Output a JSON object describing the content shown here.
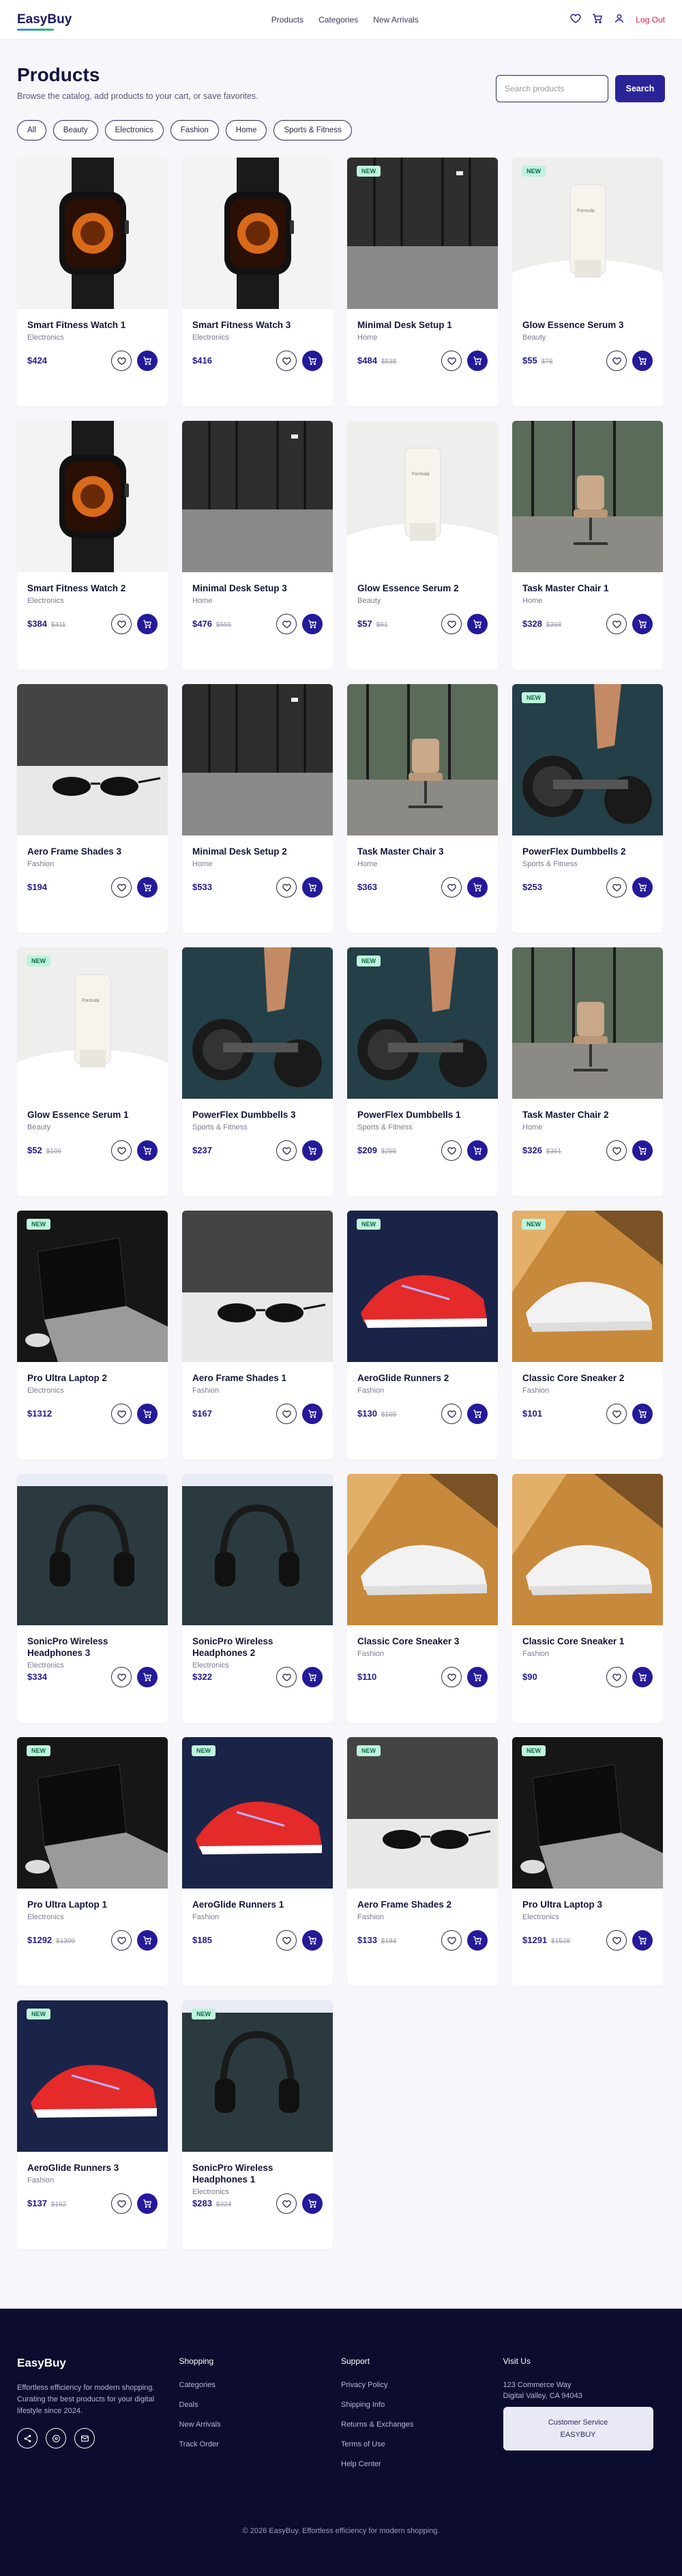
{
  "header": {
    "logo": "EasyBuy",
    "nav": [
      "Products",
      "Categories",
      "New Arrivals"
    ],
    "logout": "Log Out"
  },
  "page": {
    "title": "Products",
    "subtitle": "Browse the catalog, add products to your cart, or save favorites.",
    "search_placeholder": "Search products",
    "search_button": "Search"
  },
  "filters": [
    "All",
    "Beauty",
    "Electronics",
    "Fashion",
    "Home",
    "Sports & Fitness"
  ],
  "badge_label": "NEW",
  "products": [
    {
      "name": "Smart Fitness Watch 1",
      "category": "Electronics",
      "price": "$424",
      "old": "",
      "new": false,
      "theme": "watch"
    },
    {
      "name": "Smart Fitness Watch 3",
      "category": "Electronics",
      "price": "$416",
      "old": "",
      "new": false,
      "theme": "watch"
    },
    {
      "name": "Minimal Desk Setup 1",
      "category": "Home",
      "price": "$484",
      "old": "$538",
      "new": true,
      "theme": "desk"
    },
    {
      "name": "Glow Essence Serum 3",
      "category": "Beauty",
      "price": "$55",
      "old": "$78",
      "new": true,
      "theme": "serum"
    },
    {
      "name": "Smart Fitness Watch 2",
      "category": "Electronics",
      "price": "$384",
      "old": "$411",
      "new": false,
      "theme": "watch"
    },
    {
      "name": "Minimal Desk Setup 3",
      "category": "Home",
      "price": "$476",
      "old": "$555",
      "new": false,
      "theme": "desk"
    },
    {
      "name": "Glow Essence Serum 2",
      "category": "Beauty",
      "price": "$57",
      "old": "$81",
      "new": false,
      "theme": "serum"
    },
    {
      "name": "Task Master Chair 1",
      "category": "Home",
      "price": "$328",
      "old": "$368",
      "new": false,
      "theme": "chair"
    },
    {
      "name": "Aero Frame Shades 3",
      "category": "Fashion",
      "price": "$194",
      "old": "",
      "new": false,
      "theme": "shades"
    },
    {
      "name": "Minimal Desk Setup 2",
      "category": "Home",
      "price": "$533",
      "old": "",
      "new": false,
      "theme": "desk"
    },
    {
      "name": "Task Master Chair 3",
      "category": "Home",
      "price": "$363",
      "old": "",
      "new": false,
      "theme": "chair"
    },
    {
      "name": "PowerFlex Dumbbells 2",
      "category": "Sports & Fitness",
      "price": "$253",
      "old": "",
      "new": true,
      "theme": "dumb"
    },
    {
      "name": "Glow Essence Serum 1",
      "category": "Beauty",
      "price": "$52",
      "old": "$109",
      "new": true,
      "theme": "serum"
    },
    {
      "name": "PowerFlex Dumbbells 3",
      "category": "Sports & Fitness",
      "price": "$237",
      "old": "",
      "new": false,
      "theme": "dumb"
    },
    {
      "name": "PowerFlex Dumbbells 1",
      "category": "Sports & Fitness",
      "price": "$209",
      "old": "$255",
      "new": true,
      "theme": "dumb"
    },
    {
      "name": "Task Master Chair 2",
      "category": "Home",
      "price": "$326",
      "old": "$361",
      "new": false,
      "theme": "chair"
    },
    {
      "name": "Pro Ultra Laptop 2",
      "category": "Electronics",
      "price": "$1312",
      "old": "",
      "new": true,
      "theme": "laptop"
    },
    {
      "name": "Aero Frame Shades 1",
      "category": "Fashion",
      "price": "$167",
      "old": "",
      "new": false,
      "theme": "shades"
    },
    {
      "name": "AeroGlide Runners 2",
      "category": "Fashion",
      "price": "$130",
      "old": "$169",
      "new": true,
      "theme": "shoe-red"
    },
    {
      "name": "Classic Core Sneaker 2",
      "category": "Fashion",
      "price": "$101",
      "old": "",
      "new": true,
      "theme": "shoe-white"
    },
    {
      "name": "SonicPro Wireless Headphones 3",
      "category": "Electronics",
      "price": "$334",
      "old": "",
      "new": false,
      "theme": "head"
    },
    {
      "name": "SonicPro Wireless Headphones 2",
      "category": "Electronics",
      "price": "$322",
      "old": "",
      "new": false,
      "theme": "head"
    },
    {
      "name": "Classic Core Sneaker 3",
      "category": "Fashion",
      "price": "$110",
      "old": "",
      "new": false,
      "theme": "shoe-white"
    },
    {
      "name": "Classic Core Sneaker 1",
      "category": "Fashion",
      "price": "$90",
      "old": "",
      "new": false,
      "theme": "shoe-white"
    },
    {
      "name": "Pro Ultra Laptop 1",
      "category": "Electronics",
      "price": "$1292",
      "old": "$1399",
      "new": true,
      "theme": "laptop"
    },
    {
      "name": "AeroGlide Runners 1",
      "category": "Fashion",
      "price": "$185",
      "old": "",
      "new": true,
      "theme": "shoe-red"
    },
    {
      "name": "Aero Frame Shades 2",
      "category": "Fashion",
      "price": "$133",
      "old": "$184",
      "new": true,
      "theme": "shades"
    },
    {
      "name": "Pro Ultra Laptop 3",
      "category": "Electronics",
      "price": "$1291",
      "old": "$1528",
      "new": true,
      "theme": "laptop"
    },
    {
      "name": "AeroGlide Runners 3",
      "category": "Fashion",
      "price": "$137",
      "old": "$162",
      "new": true,
      "theme": "shoe-red"
    },
    {
      "name": "SonicPro Wireless Headphones 1",
      "category": "Electronics",
      "price": "$283",
      "old": "$324",
      "new": true,
      "theme": "head"
    }
  ],
  "footer": {
    "brand": "EasyBuy",
    "tagline": "Effortless efficiency for modern shopping. Curating the best products for your digital lifestyle since 2024.",
    "shopping_title": "Shopping",
    "shopping": [
      "Categories",
      "Deals",
      "New Arrivals",
      "Track Order"
    ],
    "support_title": "Support",
    "support": [
      "Privacy Policy",
      "Shipping Info",
      "Returns & Exchanges",
      "Terms of Use",
      "Help Center"
    ],
    "visit_title": "Visit Us",
    "address1": "123 Commerce Way",
    "address2": "Digital Valley, CA 94043",
    "cs_label": "Customer Service",
    "cs_value": "EASYBUY",
    "copyright": "© 2026 EasyBuy. Effortless efficiency for modern shopping."
  }
}
